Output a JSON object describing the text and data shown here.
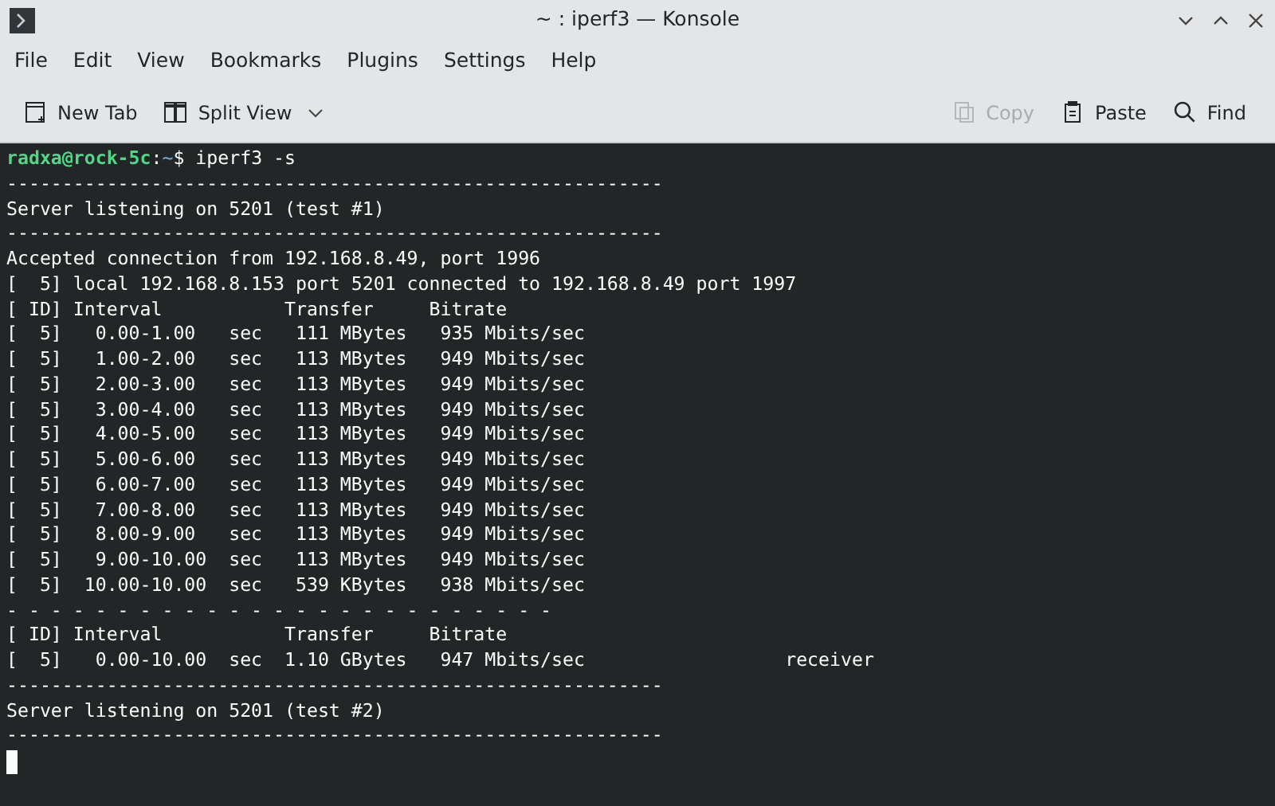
{
  "window": {
    "title": "~ : iperf3 — Konsole"
  },
  "menu": [
    "File",
    "Edit",
    "View",
    "Bookmarks",
    "Plugins",
    "Settings",
    "Help"
  ],
  "toolbar": [
    {
      "label": "New Tab",
      "kind": "new-tab",
      "disabled": false
    },
    {
      "label": "Split View",
      "kind": "split",
      "disabled": false
    },
    {
      "label": "Copy",
      "kind": "copy",
      "disabled": true
    },
    {
      "label": "Paste",
      "kind": "paste",
      "disabled": false
    },
    {
      "label": "Find",
      "kind": "find",
      "disabled": false
    }
  ],
  "terminal": {
    "prompt": [
      {
        "text": "radxa@rock-5c",
        "kind": "user"
      },
      {
        "text": ":",
        "kind": "plain"
      },
      {
        "text": "~",
        "kind": "path"
      },
      {
        "text": "$ iperf3 -s",
        "kind": "plain"
      }
    ],
    "lines": [
      "-----------------------------------------------------------",
      "Server listening on 5201 (test #1)",
      "-----------------------------------------------------------",
      "Accepted connection from 192.168.8.49, port 1996",
      "[  5] local 192.168.8.153 port 5201 connected to 192.168.8.49 port 1997",
      "[ ID] Interval           Transfer     Bitrate",
      "[  5]   0.00-1.00   sec   111 MBytes   935 Mbits/sec",
      "[  5]   1.00-2.00   sec   113 MBytes   949 Mbits/sec",
      "[  5]   2.00-3.00   sec   113 MBytes   949 Mbits/sec",
      "[  5]   3.00-4.00   sec   113 MBytes   949 Mbits/sec",
      "[  5]   4.00-5.00   sec   113 MBytes   949 Mbits/sec",
      "[  5]   5.00-6.00   sec   113 MBytes   949 Mbits/sec",
      "[  5]   6.00-7.00   sec   113 MBytes   949 Mbits/sec",
      "[  5]   7.00-8.00   sec   113 MBytes   949 Mbits/sec",
      "[  5]   8.00-9.00   sec   113 MBytes   949 Mbits/sec",
      "[  5]   9.00-10.00  sec   113 MBytes   949 Mbits/sec",
      "[  5]  10.00-10.00  sec   539 KBytes   938 Mbits/sec",
      "- - - - - - - - - - - - - - - - - - - - - - - - -",
      "[ ID] Interval           Transfer     Bitrate",
      "[  5]   0.00-10.00  sec  1.10 GBytes   947 Mbits/sec                  receiver",
      "-----------------------------------------------------------",
      "Server listening on 5201 (test #2)",
      "-----------------------------------------------------------"
    ]
  }
}
